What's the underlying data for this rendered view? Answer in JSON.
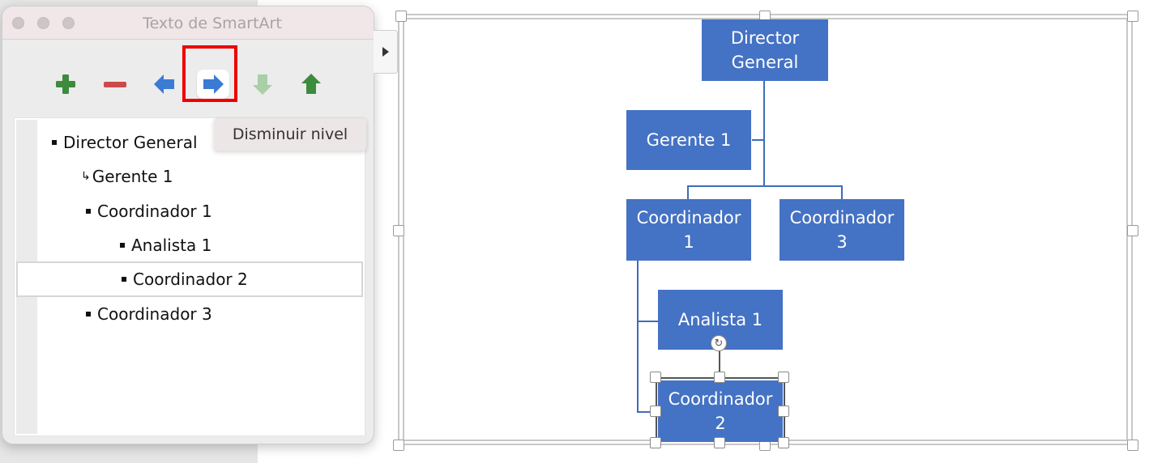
{
  "pane": {
    "title": "Texto de SmartArt",
    "toolbar": [
      {
        "id": "add",
        "label": "Agregar",
        "icon": "plus-icon",
        "color": "#3d8b3d",
        "enabled": true
      },
      {
        "id": "remove",
        "label": "Quitar",
        "icon": "minus-icon",
        "color": "#cc4a4a",
        "enabled": true
      },
      {
        "id": "promote",
        "label": "Aumentar nivel",
        "icon": "arrow-left-icon",
        "color": "#3b7bd4",
        "enabled": true
      },
      {
        "id": "demote",
        "label": "Disminuir nivel",
        "icon": "arrow-right-icon",
        "color": "#3b7bd4",
        "enabled": true,
        "active": true
      },
      {
        "id": "move-down",
        "label": "Bajar",
        "icon": "arrow-down-icon",
        "color": "#a9cfa6",
        "enabled": false
      },
      {
        "id": "move-up",
        "label": "Subir",
        "icon": "arrow-up-icon",
        "color": "#3d8b3d",
        "enabled": true
      }
    ],
    "tooltip": "Disminuir nivel",
    "items": [
      {
        "text": "Director General",
        "level": 0,
        "marker": "bullet"
      },
      {
        "text": "Gerente 1",
        "level": 1,
        "marker": "assistant"
      },
      {
        "text": "Coordinador 1",
        "level": 1,
        "marker": "bullet"
      },
      {
        "text": "Analista 1",
        "level": 2,
        "marker": "bullet"
      },
      {
        "text": "Coordinador 2",
        "level": 2,
        "marker": "bullet",
        "selected": true
      },
      {
        "text": "Coordinador 3",
        "level": 1,
        "marker": "bullet"
      }
    ]
  },
  "accent_color": "#4472c4",
  "highlight_color": "#ee0000",
  "orgchart": {
    "nodes": [
      {
        "id": "director",
        "label": "Director\nGeneral"
      },
      {
        "id": "gerente1",
        "label": "Gerente 1"
      },
      {
        "id": "coord1",
        "label": "Coordinador\n1"
      },
      {
        "id": "coord3",
        "label": "Coordinador\n3"
      },
      {
        "id": "analista1",
        "label": "Analista 1"
      },
      {
        "id": "coord2",
        "label": "Coordinador\n2",
        "selected": true
      }
    ]
  }
}
